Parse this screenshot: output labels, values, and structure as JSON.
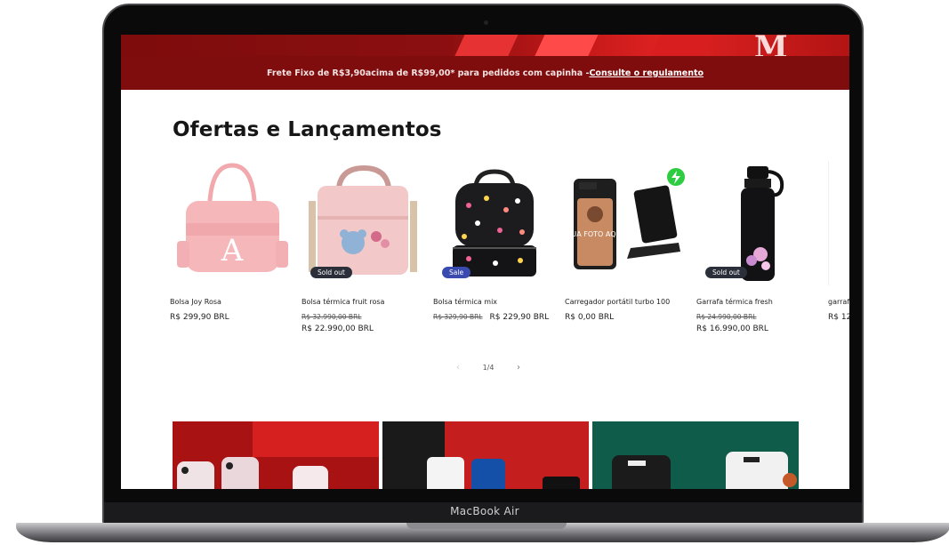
{
  "device": {
    "brand_label": "MacBook Air"
  },
  "hero": {
    "letter": "M"
  },
  "announcement": {
    "text": "Frete Fixo de R$3,90acima de R$99,00* para pedidos com capinha -",
    "link": "Consulte o regulamento"
  },
  "section": {
    "title": "Ofertas e Lançamentos"
  },
  "products": [
    {
      "name": "Bolsa Joy Rosa",
      "price": "R$ 299,90 BRL",
      "old_price": "",
      "badge": ""
    },
    {
      "name": "Bolsa térmica fruit rosa",
      "price": "R$ 22.990,00 BRL",
      "old_price": "R$ 32.990,00 BRL",
      "badge": "Sold out"
    },
    {
      "name": "Bolsa térmica mix",
      "price": "R$ 229,90 BRL",
      "old_price": "R$ 329,90 BRL",
      "badge": "Sale"
    },
    {
      "name": "Carregador portátil turbo 100",
      "price": "R$ 0,00 BRL",
      "old_price": "",
      "badge": ""
    },
    {
      "name": "Garrafa térmica fresh",
      "price": "R$ 16.990,00 BRL",
      "old_price": "R$ 24.990,00 BRL",
      "badge": "Sold out"
    },
    {
      "name": "garrafa",
      "price": "R$ 12",
      "old_price": "",
      "badge": ""
    }
  ],
  "phone_photo_text": "SUA FOTO AQUI",
  "pager": {
    "text": "1/4",
    "prev": "‹",
    "next": "›"
  },
  "colors": {
    "brand_red": "#7f0d0d",
    "badge_dark": "#2a2f3a",
    "badge_sale": "#3a4bb0"
  }
}
